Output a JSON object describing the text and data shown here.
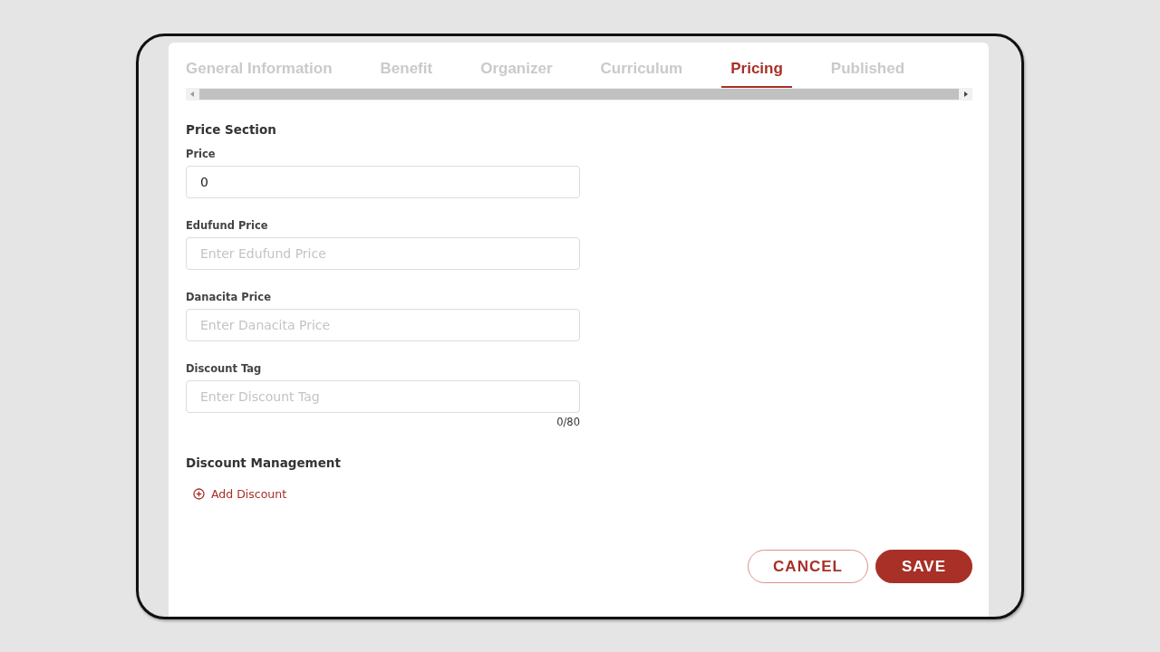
{
  "tabs": [
    {
      "label": "General Information",
      "selected": false
    },
    {
      "label": "Benefit",
      "selected": false
    },
    {
      "label": "Organizer",
      "selected": false
    },
    {
      "label": "Curriculum",
      "selected": false
    },
    {
      "label": "Pricing",
      "selected": true
    },
    {
      "label": "Published",
      "selected": false
    }
  ],
  "price_section": {
    "title": "Price Section",
    "fields": [
      {
        "label": "Price",
        "value": "0"
      },
      {
        "label": "Edufund Price",
        "placeholder": "Enter Edufund Price"
      },
      {
        "label": "Danacita Price",
        "placeholder": "Enter Danacita Price"
      },
      {
        "label": "Discount Tag",
        "placeholder": "Enter Discount Tag",
        "counter": "0/80"
      }
    ]
  },
  "discount_management": {
    "title": "Discount Management",
    "add_link": "Add Discount"
  },
  "buttons": {
    "cancel": "CANCEL",
    "save": "SAVE"
  }
}
